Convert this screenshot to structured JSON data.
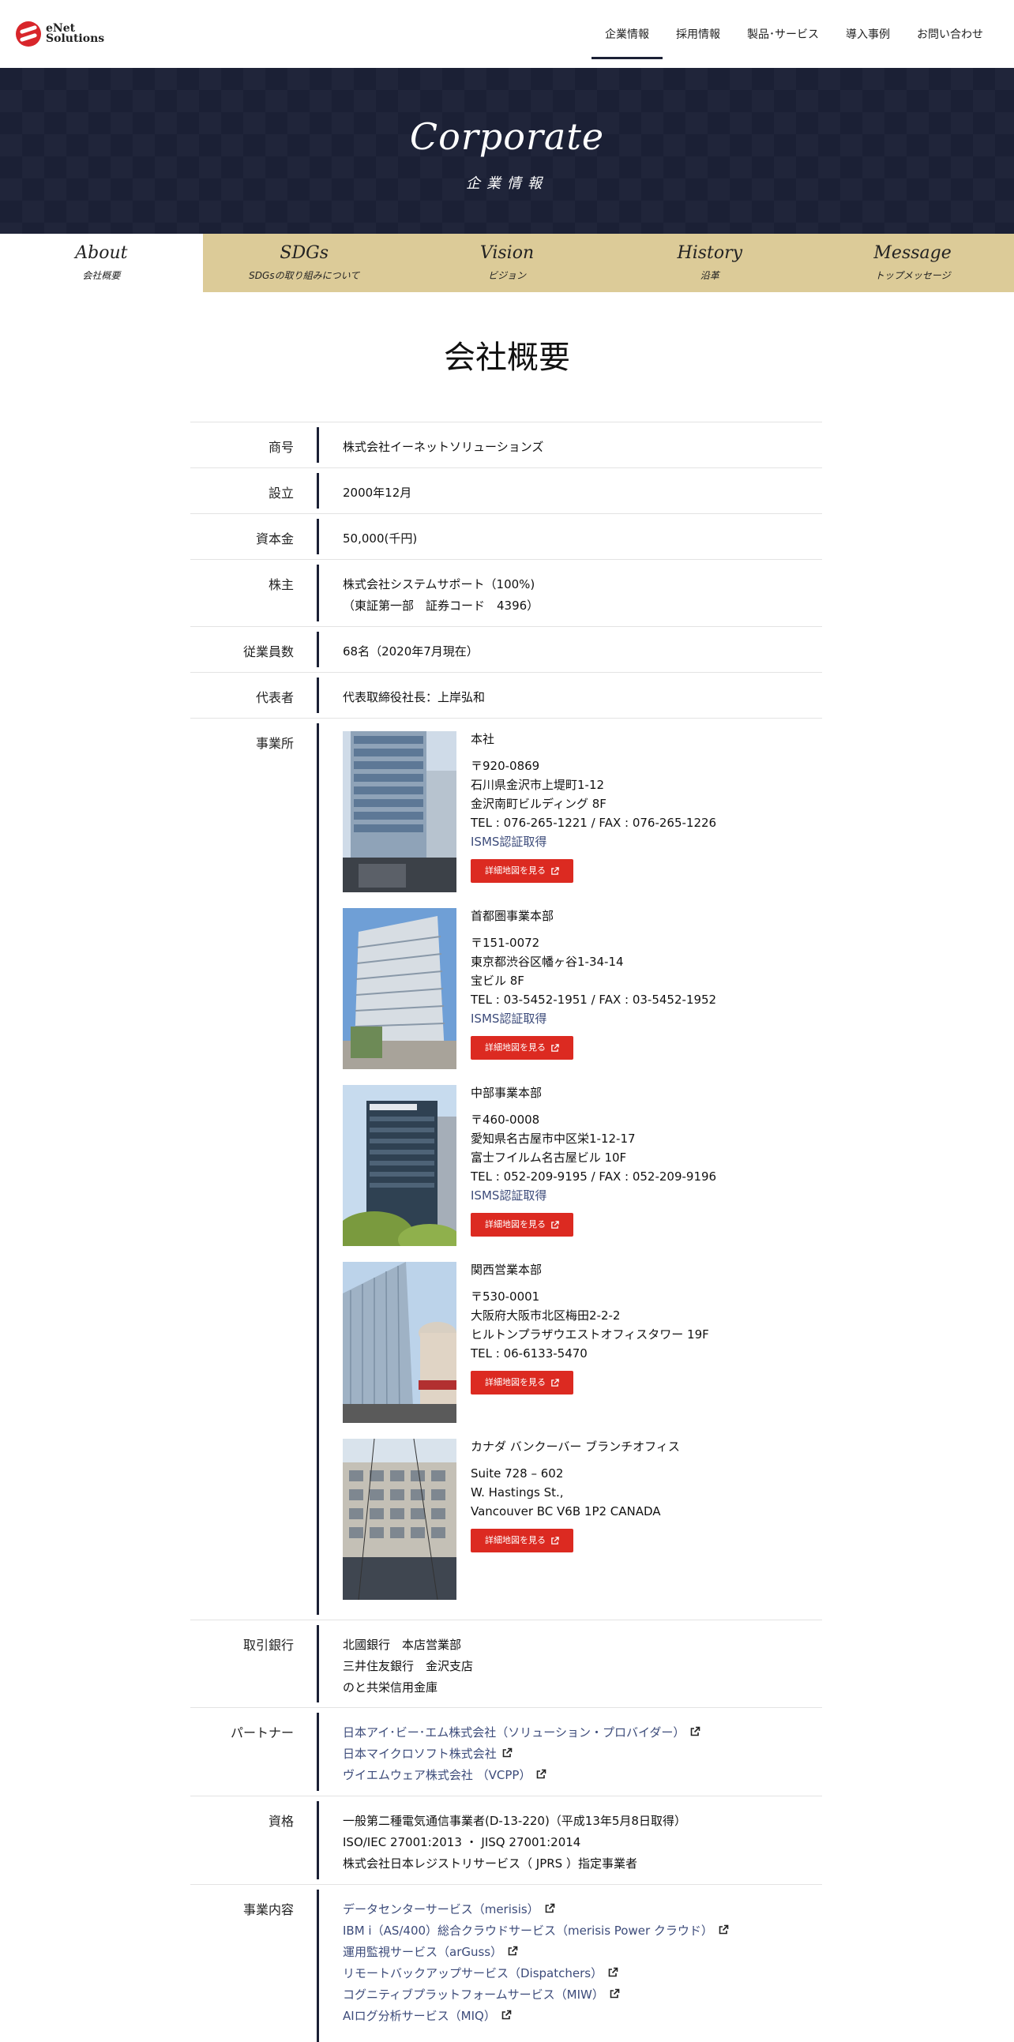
{
  "brand": {
    "line1": "eNet",
    "line2": "Solutions"
  },
  "nav": [
    "企業情報",
    "採用情報",
    "製品･サービス",
    "導入事例",
    "お問い合わせ"
  ],
  "hero": {
    "title": "Corporate",
    "subtitle": "企業情報"
  },
  "subnav": [
    {
      "en": "About",
      "ja": "会社概要"
    },
    {
      "en": "SDGs",
      "ja": "SDGsの取り組みについて"
    },
    {
      "en": "Vision",
      "ja": "ビジョン"
    },
    {
      "en": "History",
      "ja": "沿革"
    },
    {
      "en": "Message",
      "ja": "トップメッセージ"
    }
  ],
  "page_title": "会社概要",
  "company": {
    "name_label": "商号",
    "name": "株式会社イーネットソリューションズ",
    "founded_label": "設立",
    "founded": "2000年12月",
    "capital_label": "資本金",
    "capital": "50,000(千円)",
    "shareholder_label": "株主",
    "shareholder_1": "株式会社システムサポート（100%)",
    "shareholder_2": "（東証第一部　証券コード　4396）",
    "employees_label": "従業員数",
    "employees": "68名（2020年7月現在）",
    "rep_label": "代表者",
    "rep": "代表取締役社長：上岸弘和",
    "offices_label": "事業所"
  },
  "offices": [
    {
      "name": "本社",
      "zip": "〒920-0869",
      "addr1": "石川県金沢市上堤町1-12",
      "addr2": "金沢南町ビルディング 8F",
      "tel": "TEL : 076-265-1221 / FAX : 076-265-1226",
      "isms": "ISMS認証取得"
    },
    {
      "name": "首都圏事業本部",
      "zip": "〒151-0072",
      "addr1": "東京都渋谷区幡ヶ谷1-34-14",
      "addr2": "宝ビル 8F",
      "tel": "TEL : 03-5452-1951 / FAX : 03-5452-1952",
      "isms": "ISMS認証取得"
    },
    {
      "name": "中部事業本部",
      "zip": "〒460-0008",
      "addr1": "愛知県名古屋市中区栄1-12-17",
      "addr2": "富士フイルム名古屋ビル 10F",
      "tel": "TEL : 052-209-9195 / FAX : 052-209-9196",
      "isms": "ISMS認証取得"
    },
    {
      "name": "関西営業本部",
      "zip": "〒530-0001",
      "addr1": "大阪府大阪市北区梅田2-2-2",
      "addr2": "ヒルトンプラザウエストオフィスタワー 19F",
      "tel": "TEL : 06-6133-5470"
    },
    {
      "name": "カナダ バンクーバー ブランチオフィス",
      "zip": "Suite 728 – 602",
      "addr1": "W. Hastings St.,",
      "addr2": "Vancouver BC V6B 1P2 CANADA"
    }
  ],
  "map_button": "詳細地図を見る",
  "banks": {
    "label": "取引銀行",
    "items": [
      "北國銀行　本店営業部",
      "三井住友銀行　金沢支店",
      "のと共栄信用金庫"
    ]
  },
  "partners": {
    "label": "パートナー",
    "items": [
      "日本アイ･ビー･エム株式会社（ソリューション・プロバイダー）",
      "日本マイクロソフト株式会社",
      "ヴイエムウェア株式会社 （VCPP）"
    ]
  },
  "qualifications": {
    "label": "資格",
    "items": [
      "一般第二種電気通信事業者(D-13-220)（平成13年5月8日取得）",
      "ISO/IEC 27001:2013 ・ JISQ 27001:2014",
      "株式会社日本レジストリサービス（ JPRS ）指定事業者"
    ]
  },
  "business": {
    "label": "事業内容",
    "items": [
      "データセンターサービス（merisis）",
      "IBM i（AS/400）総合クラウドサービス（merisis Power クラウド）",
      "運用監視サービス（arGuss）",
      "リモートバックアップサービス（Dispatchers）",
      "コグニティブプラットフォームサービス（MIW）",
      "AIログ分析サービス（MIQ）"
    ]
  },
  "colors": {
    "navy": "#1b2035",
    "gold": "#dccb98",
    "red": "#dc2a21",
    "link": "#3c4b7a"
  }
}
